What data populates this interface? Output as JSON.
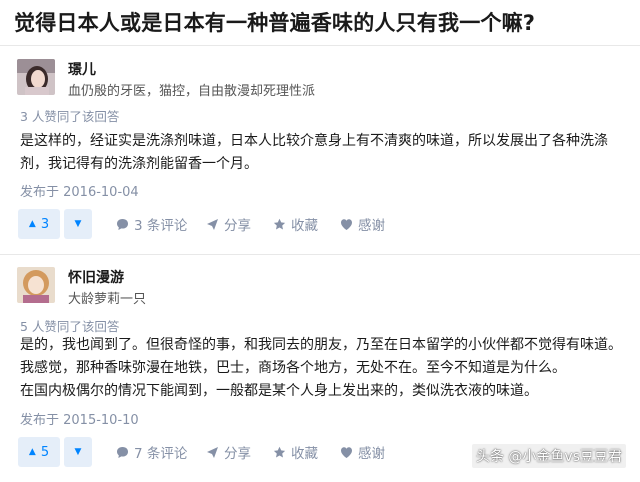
{
  "question": {
    "title": "觉得日本人或是日本有一种普遍香味的人只有我一个嘛?"
  },
  "answers": [
    {
      "author": {
        "name": "璟儿",
        "bio": "血仍殷的牙医，猫控，自由散漫却死理性派"
      },
      "upvote_text": "3 人赞同了该回答",
      "content": [
        "是这样的，经证实是洗涤剂味道，日本人比较介意身上有不清爽的味道，所以发展出了各种洗涤剂，我记得有的洗涤剂能留香一个月。"
      ],
      "published": "发布于 2016-10-04",
      "actions": {
        "vote_count": "3",
        "comments": "3 条评论",
        "share": "分享",
        "favorite": "收藏",
        "thanks": "感谢"
      }
    },
    {
      "author": {
        "name": "怀旧漫游",
        "bio": "大龄萝莉一只"
      },
      "upvote_text": "5 人赞同了该回答",
      "content": [
        "是的，我也闻到了。但很奇怪的事，和我同去的朋友，乃至在日本留学的小伙伴都不觉得有味道。",
        "我感觉，那种香味弥漫在地铁，巴士，商场各个地方，无处不在。至今不知道是为什么。",
        "在国内极偶尔的情况下能闻到，一般都是某个人身上发出来的，类似洗衣液的味道。"
      ],
      "published": "发布于 2015-10-10",
      "actions": {
        "vote_count": "5",
        "comments": "7 条评论",
        "share": "分享",
        "favorite": "收藏",
        "thanks": "感谢"
      }
    }
  ],
  "watermark": "头条 @小金鱼vs豆豆君",
  "colors": {
    "accent": "#0084ff",
    "vote_bg": "#e5eef9",
    "meta": "#8590a6"
  }
}
